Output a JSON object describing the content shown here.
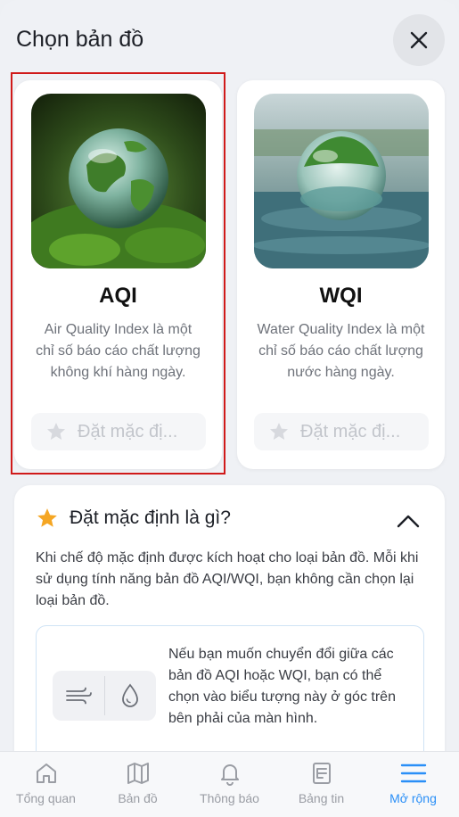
{
  "header": {
    "title": "Chọn bản đồ",
    "close_icon": "close-icon"
  },
  "cards": [
    {
      "title": "AQI",
      "description": "Air Quality Index là một chỉ số báo cáo chất lượng không khí hàng ngày.",
      "default_label": "Đặt mặc đị..."
    },
    {
      "title": "WQI",
      "description": "Water Quality Index là một chỉ số báo cáo chất lượng nước hàng ngày.",
      "default_label": "Đặt mặc đị..."
    }
  ],
  "info": {
    "title": "Đặt mặc định là gì?",
    "text": "Khi chế độ mặc định được kích hoạt cho loại bản đồ. Mỗi khi sử dụng tính năng bản đồ AQI/WQI, bạn không cần chọn lại loại bản đồ.",
    "hint": "Nếu bạn muốn chuyển đổi giữa các bản đồ AQI hoặc WQI, bạn có thể chọn vào biểu tượng này ở góc trên bên phải của màn hình."
  },
  "tabs": [
    {
      "label": "Tổng quan",
      "icon": "home-icon"
    },
    {
      "label": "Bản đồ",
      "icon": "map-icon"
    },
    {
      "label": "Thông báo",
      "icon": "bell-icon"
    },
    {
      "label": "Bảng tin",
      "icon": "news-icon"
    },
    {
      "label": "Mở rộng",
      "icon": "menu-icon"
    }
  ],
  "colors": {
    "accent": "#2a8ff7",
    "star": "#f5a623",
    "selection": "#d01a1a"
  }
}
